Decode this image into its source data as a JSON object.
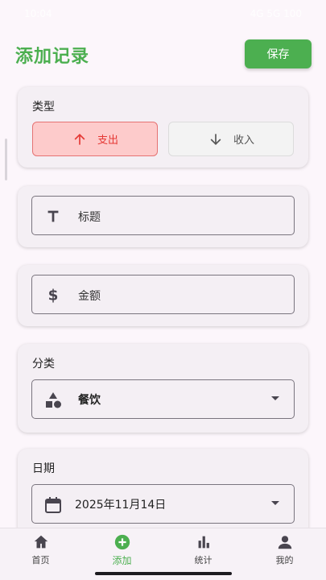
{
  "status_bar": {
    "time": "10:04",
    "right_text": "4G  5G  100"
  },
  "header": {
    "title": "添加记录",
    "save_label": "保存"
  },
  "type_section": {
    "label": "类型",
    "options": [
      {
        "label": "支出",
        "icon": "arrow-up-icon",
        "selected": true
      },
      {
        "label": "收入",
        "icon": "arrow-down-icon",
        "selected": false
      }
    ]
  },
  "title_field": {
    "placeholder": "标题",
    "icon": "text-title-icon"
  },
  "amount_field": {
    "placeholder": "金额",
    "icon": "dollar-icon"
  },
  "category_section": {
    "label": "分类",
    "selected": "餐饮",
    "icon": "category-shapes-icon"
  },
  "date_section": {
    "label": "日期",
    "selected": "2025年11月14日",
    "icon": "calendar-icon"
  },
  "bottom_nav": [
    {
      "label": "首页",
      "icon": "home-icon",
      "active": false
    },
    {
      "label": "添加",
      "icon": "add-circle-icon",
      "active": true
    },
    {
      "label": "统计",
      "icon": "bar-chart-icon",
      "active": false
    },
    {
      "label": "我的",
      "icon": "person-icon",
      "active": false
    }
  ],
  "colors": {
    "accent": "#4caf50",
    "expense": "#e53935",
    "expense_bg": "#fdcbcb",
    "background": "#fcf6fb"
  }
}
